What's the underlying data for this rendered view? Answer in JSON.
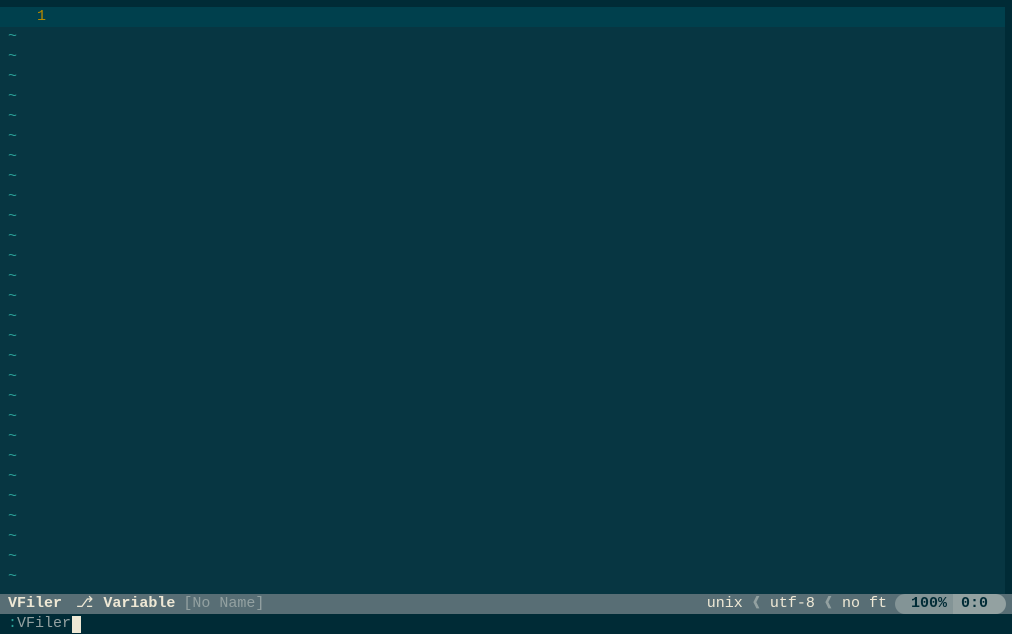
{
  "editor": {
    "current_line_number": "1",
    "current_line_content": "",
    "tilde": "~",
    "tilde_count": 28
  },
  "statusline": {
    "section_a": "VFiler",
    "branch_icon": "⎇",
    "section_b": "Variable",
    "section_c": "[No Name]",
    "fileformat": "unix",
    "encoding": "utf-8",
    "filetype": "no ft",
    "percent": "100%",
    "position": "0:0"
  },
  "commandline": {
    "prompt": ":",
    "text": "VFiler"
  }
}
